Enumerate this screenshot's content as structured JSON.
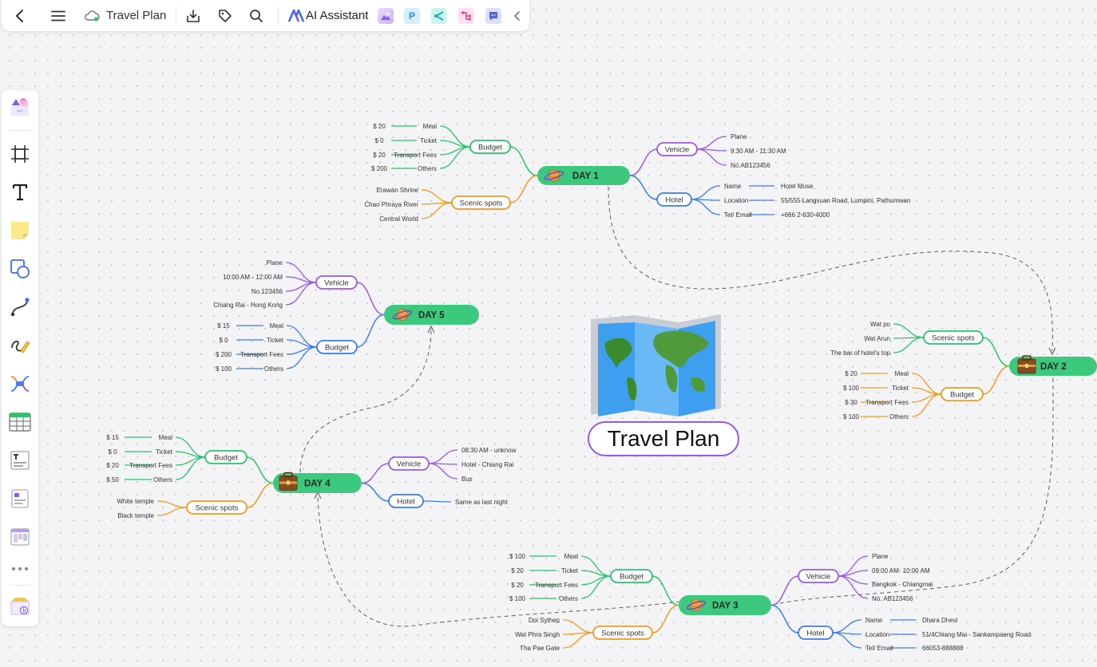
{
  "top_bar": {
    "doc_title": "Travel Plan",
    "ai_label": "AI Assistant",
    "icons": [
      "back-arrow-icon",
      "menu-icon",
      "cloud-icon",
      "download-icon",
      "tag-icon",
      "search-icon",
      "ai-logo-icon",
      "image-ai-app-icon",
      "p-app-icon",
      "flow-app-icon",
      "mindmap-app-icon",
      "chat-app-icon",
      "collapse-icon"
    ]
  },
  "left_toolbar": {
    "tools": [
      "templates-tool",
      "frame-tool",
      "text-tool",
      "sticky-note-tool",
      "shape-tool",
      "connector-tool",
      "pen-tool",
      "mindmap-tool",
      "table-tool",
      "text-box-tool",
      "card-tool",
      "kanban-tool",
      "more-tool",
      "apps-tool"
    ]
  },
  "mindmap": {
    "center_title": "Travel Plan",
    "days": [
      {
        "id": "day1",
        "label": "DAY 1",
        "icon": "planet-icon",
        "branches": [
          {
            "label": "Budget",
            "color": "green",
            "leaves": [
              [
                "$ 20",
                "Meal"
              ],
              [
                "$ 0",
                "Ticket"
              ],
              [
                "$ 20",
                "Transport Fees"
              ],
              [
                "$ 200",
                "Others"
              ]
            ]
          },
          {
            "label": "Scenic spots",
            "color": "orange",
            "leaves": [
              "Erawan Shrine",
              "Chao Phraya River",
              "Central World"
            ]
          },
          {
            "label": "Vehicle",
            "color": "purple",
            "leaves": [
              "Plane",
              "9:30 AM - 11:30 AM",
              "No.AB123456"
            ]
          },
          {
            "label": "Hotel",
            "color": "blue",
            "leaves": [
              [
                "Name",
                "Hotel Muse"
              ],
              [
                "Location",
                "55/555 Langsuan Road, Lumpini, Pathumwan"
              ],
              [
                "Tel/ Email",
                "+666 2-630-4000"
              ]
            ]
          }
        ]
      },
      {
        "id": "day2",
        "label": "DAY 2",
        "icon": "suitcase-icon",
        "branches": [
          {
            "label": "Scenic spots",
            "color": "green",
            "leaves": [
              "Wat po",
              "Wat Arun",
              "The bar of hotel's top"
            ]
          },
          {
            "label": "Budget",
            "color": "orange",
            "leaves": [
              [
                "$ 20",
                "Meal"
              ],
              [
                "$ 100",
                "Ticket"
              ],
              [
                "$ 30",
                "Transport Fees"
              ],
              [
                "$ 100",
                "Others"
              ]
            ]
          }
        ]
      },
      {
        "id": "day3",
        "label": "DAY 3",
        "icon": "planet-icon",
        "branches": [
          {
            "label": "Budget",
            "color": "green",
            "leaves": [
              [
                "$ 100",
                "Meal"
              ],
              [
                "$ 20",
                "Ticket"
              ],
              [
                "$ 20",
                "Transport Fees"
              ],
              [
                "$ 100",
                "Others"
              ]
            ]
          },
          {
            "label": "Scenic spots",
            "color": "orange",
            "leaves": [
              "Doi Sythep",
              "Wat Phra Singh",
              "Tha Pae Gate"
            ]
          },
          {
            "label": "Vehicle",
            "color": "purple",
            "leaves": [
              "Plane",
              "09:00 AM- 10:00 AM",
              "Bangkok - Chiangmai",
              "No. AB123456"
            ]
          },
          {
            "label": "Hotel",
            "color": "blue",
            "leaves": [
              [
                "Name",
                "Dhara Dhevi"
              ],
              [
                "Location",
                "51/4Chiang Mai - Sankampaeng Road"
              ],
              [
                "Tel/ Email",
                "66053-888888"
              ]
            ]
          }
        ]
      },
      {
        "id": "day4",
        "label": "DAY 4",
        "icon": "suitcase-icon",
        "branches": [
          {
            "label": "Budget",
            "color": "green",
            "leaves": [
              [
                "$ 15",
                "Meal"
              ],
              [
                "$ 0",
                "Ticket"
              ],
              [
                "$ 20",
                "Transport Fees"
              ],
              [
                "$ 50",
                "Others"
              ]
            ]
          },
          {
            "label": "Scenic spots",
            "color": "orange",
            "leaves": [
              "White temple",
              "Black temple"
            ]
          },
          {
            "label": "Vehicle",
            "color": "purple",
            "leaves": [
              "08:30 AM - unknow",
              "Hotel - Chiang Rai",
              "Bus"
            ]
          },
          {
            "label": "Hotel",
            "color": "blue",
            "leaves": [
              "Same as last night"
            ]
          }
        ]
      },
      {
        "id": "day5",
        "label": "DAY 5",
        "icon": "planet-icon",
        "branches": [
          {
            "label": "Vehicle",
            "color": "purple",
            "leaves": [
              "Plane",
              "10:00 AM - 12:00 AM",
              "No.123456",
              "Chiang Rai - Hong Kong"
            ]
          },
          {
            "label": "Budget",
            "color": "blue",
            "leaves": [
              [
                "$ 15",
                "Meal"
              ],
              [
                "$ 0",
                "Ticket"
              ],
              [
                "$ 200",
                "Transport Fees"
              ],
              [
                "$ 100",
                "Others"
              ]
            ]
          }
        ]
      }
    ]
  },
  "colors": {
    "day_fill": "#3cc97d",
    "green": "#27c46b",
    "orange": "#f29a1f",
    "purple": "#9a57ee",
    "blue": "#3a7cf0",
    "center_border": "#9a57ee",
    "dashed": "#6b6b6b"
  }
}
